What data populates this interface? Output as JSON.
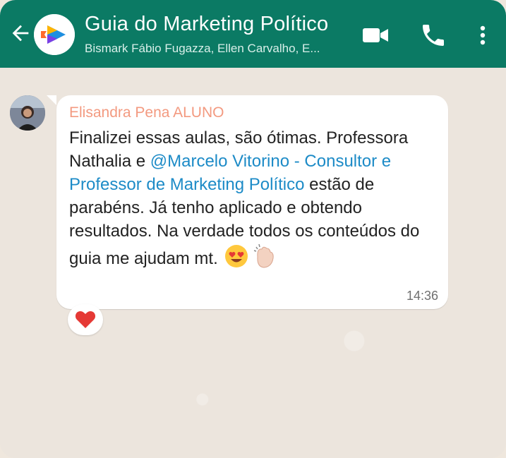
{
  "header": {
    "title": "Guia do Marketing Político",
    "subtitle": "Bismark Fábio Fugazza, Ellen Carvalho, E..."
  },
  "message": {
    "sender": "Elisandra Pena ALUNO",
    "text_part1": "Finalizei essas aulas, são ótimas. Professora Nathalia e ",
    "mention": "@Marcelo Vitorino - Consultor e Professor de Marketing Político",
    "text_part2": " estão de parabéns. Já tenho aplicado e obtendo resultados. Na verdade todos os conteúdos do guia me ajudam mt. ",
    "emojis": [
      "heart-eyes-emoji",
      "clapping-hands-emoji"
    ],
    "time": "14:36",
    "reaction": "heart-icon"
  },
  "colors": {
    "header_bg": "#0b7a64",
    "sender_name": "#f39a80",
    "mention": "#1d8bc7",
    "reaction_heart": "#e53935"
  }
}
